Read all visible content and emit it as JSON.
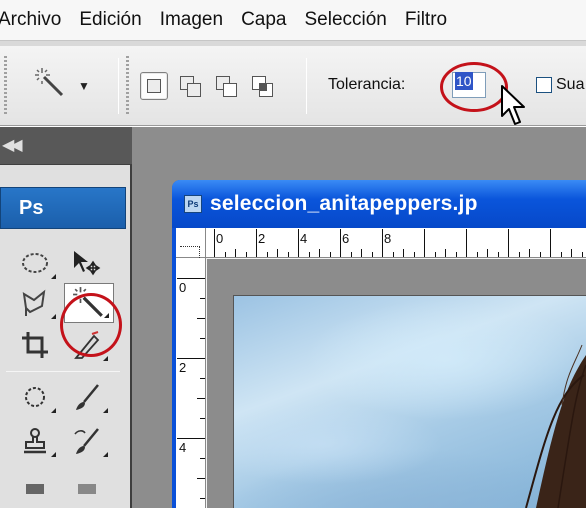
{
  "menu": {
    "items": [
      "Archivo",
      "Edición",
      "Imagen",
      "Capa",
      "Selección",
      "Filtro"
    ]
  },
  "options_bar": {
    "tool_icon": "magic-wand-icon",
    "selection_modes": [
      "new-selection",
      "add-to-selection",
      "subtract-from-selection",
      "intersect-selection"
    ],
    "active_mode": "new-selection",
    "tolerance_label": "Tolerancia:",
    "tolerance_value": "10",
    "antialias_label": "Sua",
    "antialias_checked": false
  },
  "tools": {
    "header": "Ps",
    "active_tool": "magic-wand"
  },
  "document": {
    "title": "seleccion_anitapeppers.jp",
    "ruler_top": [
      "0",
      "2",
      "4",
      "6",
      "8"
    ],
    "ruler_left": [
      "0",
      "2",
      "4"
    ]
  },
  "colors": {
    "highlight": "#c4121a",
    "titlebar": "#0a55db",
    "ps_header": "#2876c8"
  }
}
